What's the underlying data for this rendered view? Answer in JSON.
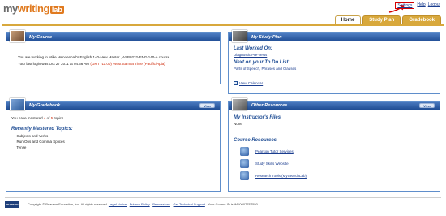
{
  "header": {
    "logo": {
      "my": "my",
      "writing": "writing",
      "lab": "lab"
    },
    "links": {
      "settings": "Settings",
      "help": "Help",
      "logout": "Logout"
    },
    "tabs": [
      {
        "label": "Home",
        "active": true
      },
      {
        "label": "Study Plan",
        "active": false
      },
      {
        "label": "Gradebook",
        "active": false
      }
    ]
  },
  "course": {
    "title": "My Course",
    "line1": "You are working in Mike Mendenhall's English 140-New Master , ASB0232-ENG-140-A course.",
    "line2_prefix": "Your last login was Oct 27 2011 at 04:36 AM",
    "line2_tz": "(GMT -11:00) West Samoa Time (Pacific/Apia)"
  },
  "study_plan": {
    "title": "My Study Plan",
    "last_worked_label": "Last Worked On:",
    "last_worked_link": "Diagnostic Pre-Tests",
    "next_label": "Next on your To Do List:",
    "next_link": "Parts of Speech, Phrases and Clauses",
    "calendar_link": "View Calendar"
  },
  "gradebook": {
    "title": "My Gradebook",
    "view_label": "View",
    "mastered_prefix": "You have mastered",
    "mastered_count": "4",
    "mastered_of": "of",
    "mastered_total": "5",
    "mastered_suffix": "topics",
    "recent_title": "Recently Mastered Topics:",
    "topics": [
      "Subjects and Verbs",
      "Run Ons and Comma Splices",
      "Tense"
    ]
  },
  "resources": {
    "title": "Other Resources",
    "view_label": "View",
    "instructor_title": "My Instructor's Files",
    "instructor_value": "None",
    "course_res_title": "Course Resources",
    "items": [
      "Pearson Tutor Services",
      "Study Skills Website",
      "Research Tools (MySearchLab)"
    ]
  },
  "footer": {
    "logo": "PEARSON",
    "copyright": "Copyright © Pearson Education, Inc. All rights reserved.",
    "legal": "Legal Notice",
    "privacy": "Privacy Policy",
    "permissions": "Permissions",
    "support": "Get Technical Support",
    "course_id": "Your Course ID is WU00077F7550"
  },
  "colors": {
    "accent": "#d8a83c",
    "panel_blue": "#1f4d94",
    "highlight": "#d40000"
  }
}
